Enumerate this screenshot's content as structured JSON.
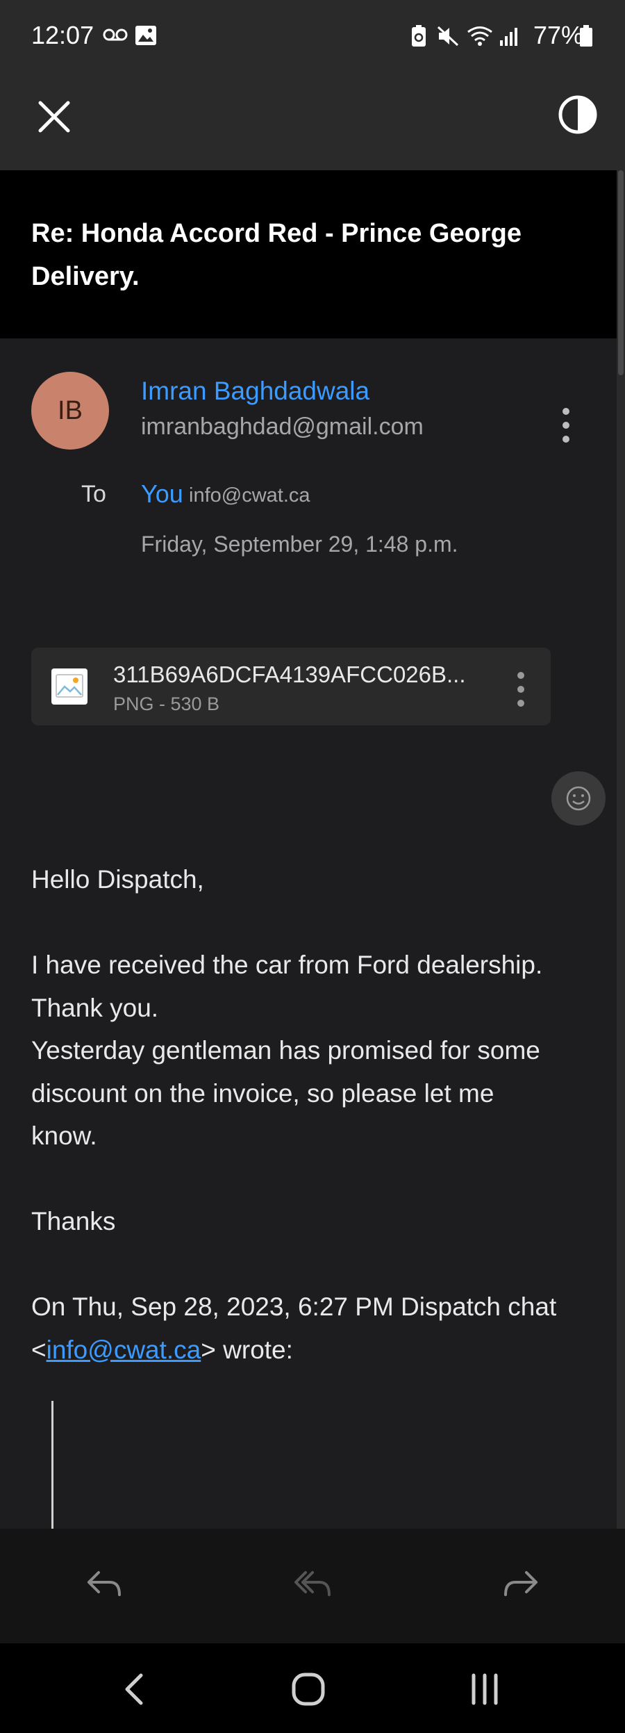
{
  "status_bar": {
    "time": "12:07",
    "battery": "77%"
  },
  "subject": "Re: Honda Accord Red - Prince George Delivery.",
  "sender": {
    "initials": "IB",
    "name": "Imran Baghdadwala",
    "email": "imranbaghdad@gmail.com",
    "avatar_color": "#c9836d"
  },
  "recipients": {
    "to_label": "To",
    "to_name": "You",
    "to_email": "info@cwat.ca"
  },
  "date": "Friday, September 29, 1:48 p.m.",
  "attachment": {
    "name": "311B69A6DCFA4139AFCC026B...",
    "meta": "PNG - 530 B"
  },
  "message": {
    "greeting": "Hello Dispatch,",
    "line1": "I have received the car from Ford dealership.",
    "line2": "Thank you.",
    "line3": "Yesterday gentleman has promised for some",
    "line4": "discount on the invoice, so please let me",
    "line5": "know.",
    "signoff": "Thanks",
    "quote_header_1": "On Thu, Sep 28, 2023, 6:27 PM Dispatch chat",
    "quote_lt": "<",
    "quote_link": "info@cwat.ca",
    "quote_gt": "> wrote:"
  },
  "colors": {
    "accent": "#3b9bff",
    "background": "#1d1d1f",
    "header_bg": "#2a2a2a"
  },
  "icons": {
    "close": "close-icon",
    "contrast": "contrast-icon",
    "more": "more-vertical-icon",
    "emoji": "emoji-icon",
    "reply": "reply-icon",
    "reply_all": "reply-all-icon",
    "forward": "forward-icon"
  }
}
